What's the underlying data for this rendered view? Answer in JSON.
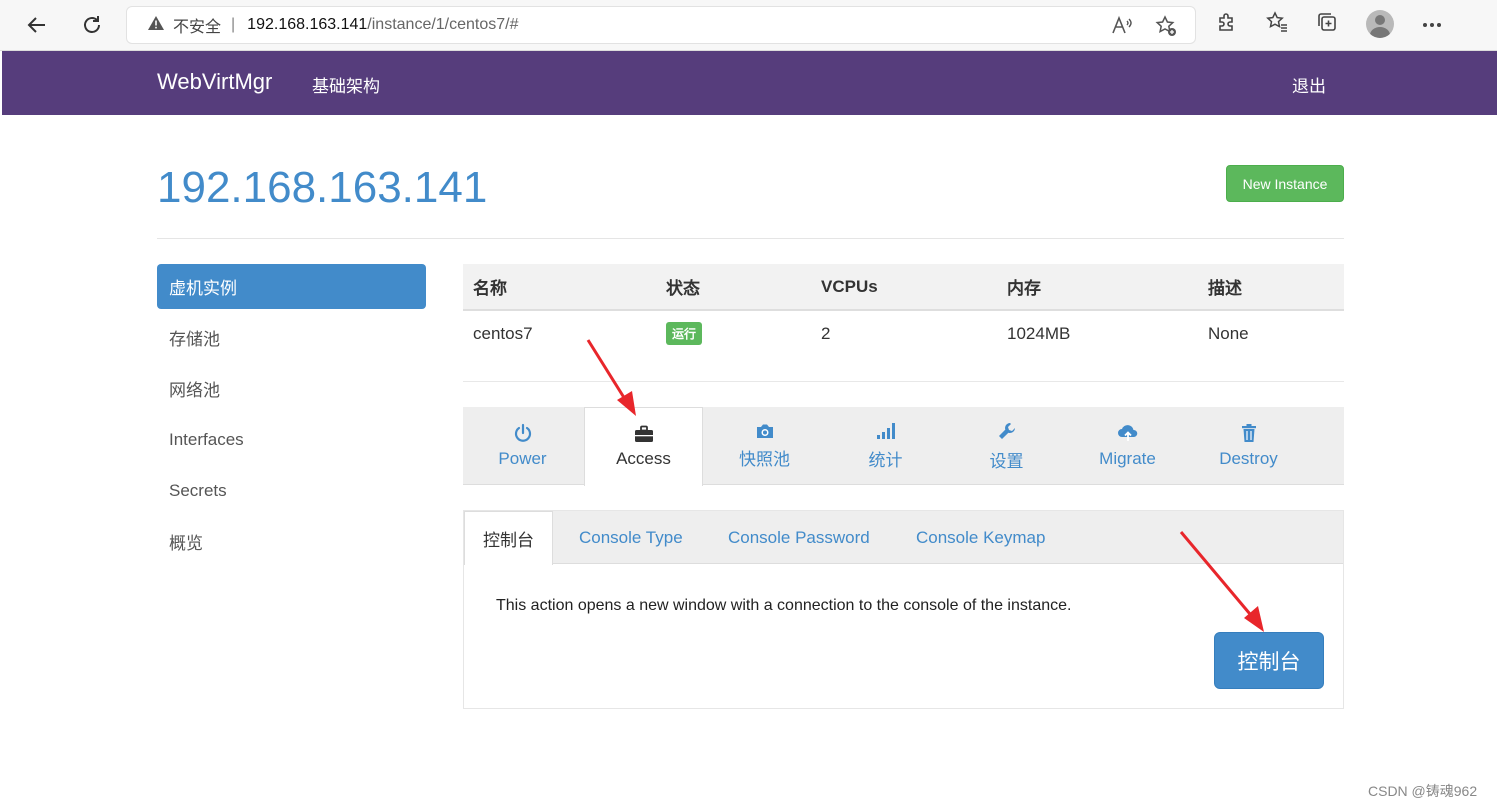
{
  "browser": {
    "insecure_label": "不安全",
    "url_host": "192.168.163.141",
    "url_path": "/instance/1/centos7/#"
  },
  "navbar": {
    "brand": "WebVirtMgr",
    "infrastructure": "基础架构",
    "logout": "退出",
    "color": "#563d7c"
  },
  "header": {
    "title": "192.168.163.141",
    "new_instance": "New Instance"
  },
  "sidebar": {
    "items": [
      {
        "label": "虚机实例",
        "active": true
      },
      {
        "label": "存储池"
      },
      {
        "label": "网络池"
      },
      {
        "label": "Interfaces"
      },
      {
        "label": "Secrets"
      },
      {
        "label": "概览"
      }
    ]
  },
  "table": {
    "headers": [
      "名称",
      "状态",
      "VCPUs",
      "内存",
      "描述"
    ],
    "row": {
      "name": "centos7",
      "status": "运行",
      "vcpus": "2",
      "memory": "1024MB",
      "description": "None"
    }
  },
  "action_tabs": [
    {
      "label": "Power",
      "icon": "power-icon"
    },
    {
      "label": "Access",
      "icon": "briefcase-icon",
      "active": true
    },
    {
      "label": "快照池",
      "icon": "camera-icon"
    },
    {
      "label": "统计",
      "icon": "signal-icon"
    },
    {
      "label": "设置",
      "icon": "wrench-icon"
    },
    {
      "label": "Migrate",
      "icon": "cloud-upload-icon"
    },
    {
      "label": "Destroy",
      "icon": "trash-icon"
    }
  ],
  "sub_tabs": [
    {
      "label": "控制台",
      "active": true
    },
    {
      "label": "Console Type"
    },
    {
      "label": "Console Password"
    },
    {
      "label": "Console Keymap"
    }
  ],
  "console": {
    "description": "This action opens a new window with a connection to the console of the instance.",
    "button": "控制台"
  },
  "watermark": "CSDN @铸魂962",
  "colors": {
    "primary": "#428bca",
    "success": "#5cb85c",
    "annotation": "#e8262b"
  }
}
